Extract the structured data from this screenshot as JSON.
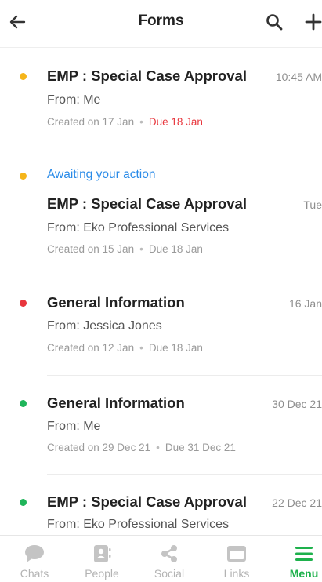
{
  "header": {
    "title": "Forms",
    "back_icon": "arrow-left-icon",
    "search_icon": "search-icon",
    "add_icon": "plus-icon"
  },
  "colors": {
    "pending": "#f5b51a",
    "urgent": "#e8363d",
    "done": "#1fb55a",
    "accent": "#1eb14c",
    "link": "#2a8be8"
  },
  "items": [
    {
      "dot": "pending",
      "title": "EMP : Special Case Approval",
      "time": "10:45 AM",
      "from": "From: Me",
      "created": "Created on 17 Jan",
      "due": "Due 18 Jan"
    },
    {
      "dot": "pending",
      "status": "Awaiting your action",
      "title": "EMP : Special Case Approval",
      "time": "Tue",
      "from": "From: Eko Professional Services",
      "created": "Created on 15 Jan",
      "due": "Due 18 Jan"
    },
    {
      "dot": "urgent",
      "title": "General Information",
      "time": "16 Jan",
      "from": "From: Jessica Jones",
      "created": "Created on 12 Jan",
      "due": "Due 18 Jan"
    },
    {
      "dot": "done",
      "title": "General Information",
      "time": "30 Dec 21",
      "from": "From: Me",
      "created": "Created on 29 Dec 21",
      "due": "Due 31 Dec 21"
    },
    {
      "dot": "done",
      "title": "EMP : Special Case Approval",
      "time": "22 Dec 21",
      "from": "From: Eko Professional Services"
    }
  ],
  "tabs": [
    {
      "label": "Chats",
      "icon": "chat-bubble-icon"
    },
    {
      "label": "People",
      "icon": "contact-card-icon"
    },
    {
      "label": "Social",
      "icon": "share-icon"
    },
    {
      "label": "Links",
      "icon": "browser-window-icon"
    },
    {
      "label": "Menu",
      "icon": "menu-icon",
      "active": true
    }
  ]
}
